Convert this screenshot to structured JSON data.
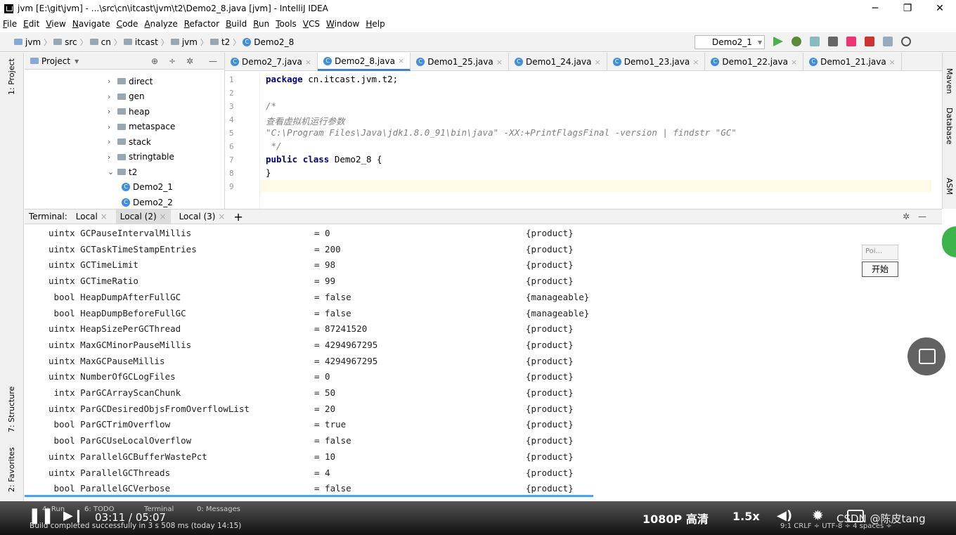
{
  "window": {
    "title": "jvm [E:\\git\\jvm] - ...\\src\\cn\\itcast\\jvm\\t2\\Demo2_8.java [jvm] - IntelliJ IDEA"
  },
  "menu": [
    "File",
    "Edit",
    "View",
    "Navigate",
    "Code",
    "Analyze",
    "Refactor",
    "Build",
    "Run",
    "Tools",
    "VCS",
    "Window",
    "Help"
  ],
  "breadcrumb": [
    "jvm",
    "src",
    "cn",
    "itcast",
    "jvm",
    "t2",
    "Demo2_8"
  ],
  "run_config": "Demo2_1",
  "project": {
    "header": "Project",
    "tree": [
      {
        "label": "direct",
        "type": "folder",
        "depth": 1,
        "expanded": false
      },
      {
        "label": "gen",
        "type": "folder",
        "depth": 1,
        "expanded": false
      },
      {
        "label": "heap",
        "type": "folder",
        "depth": 1,
        "expanded": false
      },
      {
        "label": "metaspace",
        "type": "folder",
        "depth": 1,
        "expanded": false
      },
      {
        "label": "stack",
        "type": "folder",
        "depth": 1,
        "expanded": false
      },
      {
        "label": "stringtable",
        "type": "folder",
        "depth": 1,
        "expanded": false
      },
      {
        "label": "t2",
        "type": "folder",
        "depth": 1,
        "expanded": true
      },
      {
        "label": "Demo2_1",
        "type": "class",
        "depth": 2
      },
      {
        "label": "Demo2_2",
        "type": "class",
        "depth": 2
      }
    ]
  },
  "editor": {
    "tabs": [
      "Demo2_7.java",
      "Demo2_8.java",
      "Demo1_25.java",
      "Demo1_24.java",
      "Demo1_23.java",
      "Demo1_22.java",
      "Demo1_21.java"
    ],
    "active_tab": 1,
    "lines": [
      {
        "n": "1",
        "text": "package cn.itcast.jvm.t2;"
      },
      {
        "n": "2",
        "text": ""
      },
      {
        "n": "3",
        "text": "/*"
      },
      {
        "n": "4",
        "text": "查看虚拟机运行参数"
      },
      {
        "n": "5",
        "text": "\"C:\\Program Files\\Java\\jdk1.8.0_91\\bin\\java\" -XX:+PrintFlagsFinal -version | findstr \"GC\""
      },
      {
        "n": "6",
        "text": " */"
      },
      {
        "n": "7",
        "text": "public class Demo2_8 {"
      },
      {
        "n": "8",
        "text": "}"
      },
      {
        "n": "9",
        "text": ""
      }
    ]
  },
  "side_tools": {
    "left": [
      "1: Project",
      "7: Structure",
      "2: Favorites"
    ],
    "right": [
      "Maven",
      "Database",
      "ASM"
    ]
  },
  "terminal": {
    "label": "Terminal:",
    "tabs": [
      "Local",
      "Local (2)",
      "Local (3)"
    ],
    "rows": [
      {
        "type": "uintx",
        "name": "GCPauseIntervalMillis",
        "value": "= 0",
        "kind": "{product}"
      },
      {
        "type": "uintx",
        "name": "GCTaskTimeStampEntries",
        "value": "= 200",
        "kind": "{product}"
      },
      {
        "type": "uintx",
        "name": "GCTimeLimit",
        "value": "= 98",
        "kind": "{product}"
      },
      {
        "type": "uintx",
        "name": "GCTimeRatio",
        "value": "= 99",
        "kind": "{product}"
      },
      {
        "type": " bool",
        "name": "HeapDumpAfterFullGC",
        "value": "= false",
        "kind": "{manageable}"
      },
      {
        "type": " bool",
        "name": "HeapDumpBeforeFullGC",
        "value": "= false",
        "kind": "{manageable}"
      },
      {
        "type": "uintx",
        "name": "HeapSizePerGCThread",
        "value": "= 87241520",
        "kind": "{product}"
      },
      {
        "type": "uintx",
        "name": "MaxGCMinorPauseMillis",
        "value": "= 4294967295",
        "kind": "{product}"
      },
      {
        "type": "uintx",
        "name": "MaxGCPauseMillis",
        "value": "= 4294967295",
        "kind": "{product}"
      },
      {
        "type": "uintx",
        "name": "NumberOfGCLogFiles",
        "value": "= 0",
        "kind": "{product}"
      },
      {
        "type": " intx",
        "name": "ParGCArrayScanChunk",
        "value": "= 50",
        "kind": "{product}"
      },
      {
        "type": "uintx",
        "name": "ParGCDesiredObjsFromOverflowList",
        "value": "= 20",
        "kind": "{product}"
      },
      {
        "type": " bool",
        "name": "ParGCTrimOverflow",
        "value": "= true",
        "kind": "{product}"
      },
      {
        "type": " bool",
        "name": "ParGCUseLocalOverflow",
        "value": "= false",
        "kind": "{product}"
      },
      {
        "type": "uintx",
        "name": "ParallelGCBufferWastePct",
        "value": "= 10",
        "kind": "{product}"
      },
      {
        "type": "uintx",
        "name": "ParallelGCThreads",
        "value": "= 4",
        "kind": "{product}"
      },
      {
        "type": " bool",
        "name": "ParallelGCVerbose",
        "value": "= false",
        "kind": "{product}"
      }
    ]
  },
  "popup": {
    "title": "Poi...",
    "button": "开始"
  },
  "bottom_tools": [
    "4: Run",
    "6: TODO",
    "Terminal",
    "0: Messages"
  ],
  "status_text": "Build completed successfully in 3 s 508 ms (today 14:15)",
  "status_right": "9:1  CRLF ÷  UTF-8 ÷  4 spaces ÷",
  "video": {
    "time": "03:11 / 05:07",
    "quality": "1080P 高清",
    "speed": "1.5x",
    "watermark": "CSDN @陈皮tang",
    "progress_fraction": 0.62
  }
}
